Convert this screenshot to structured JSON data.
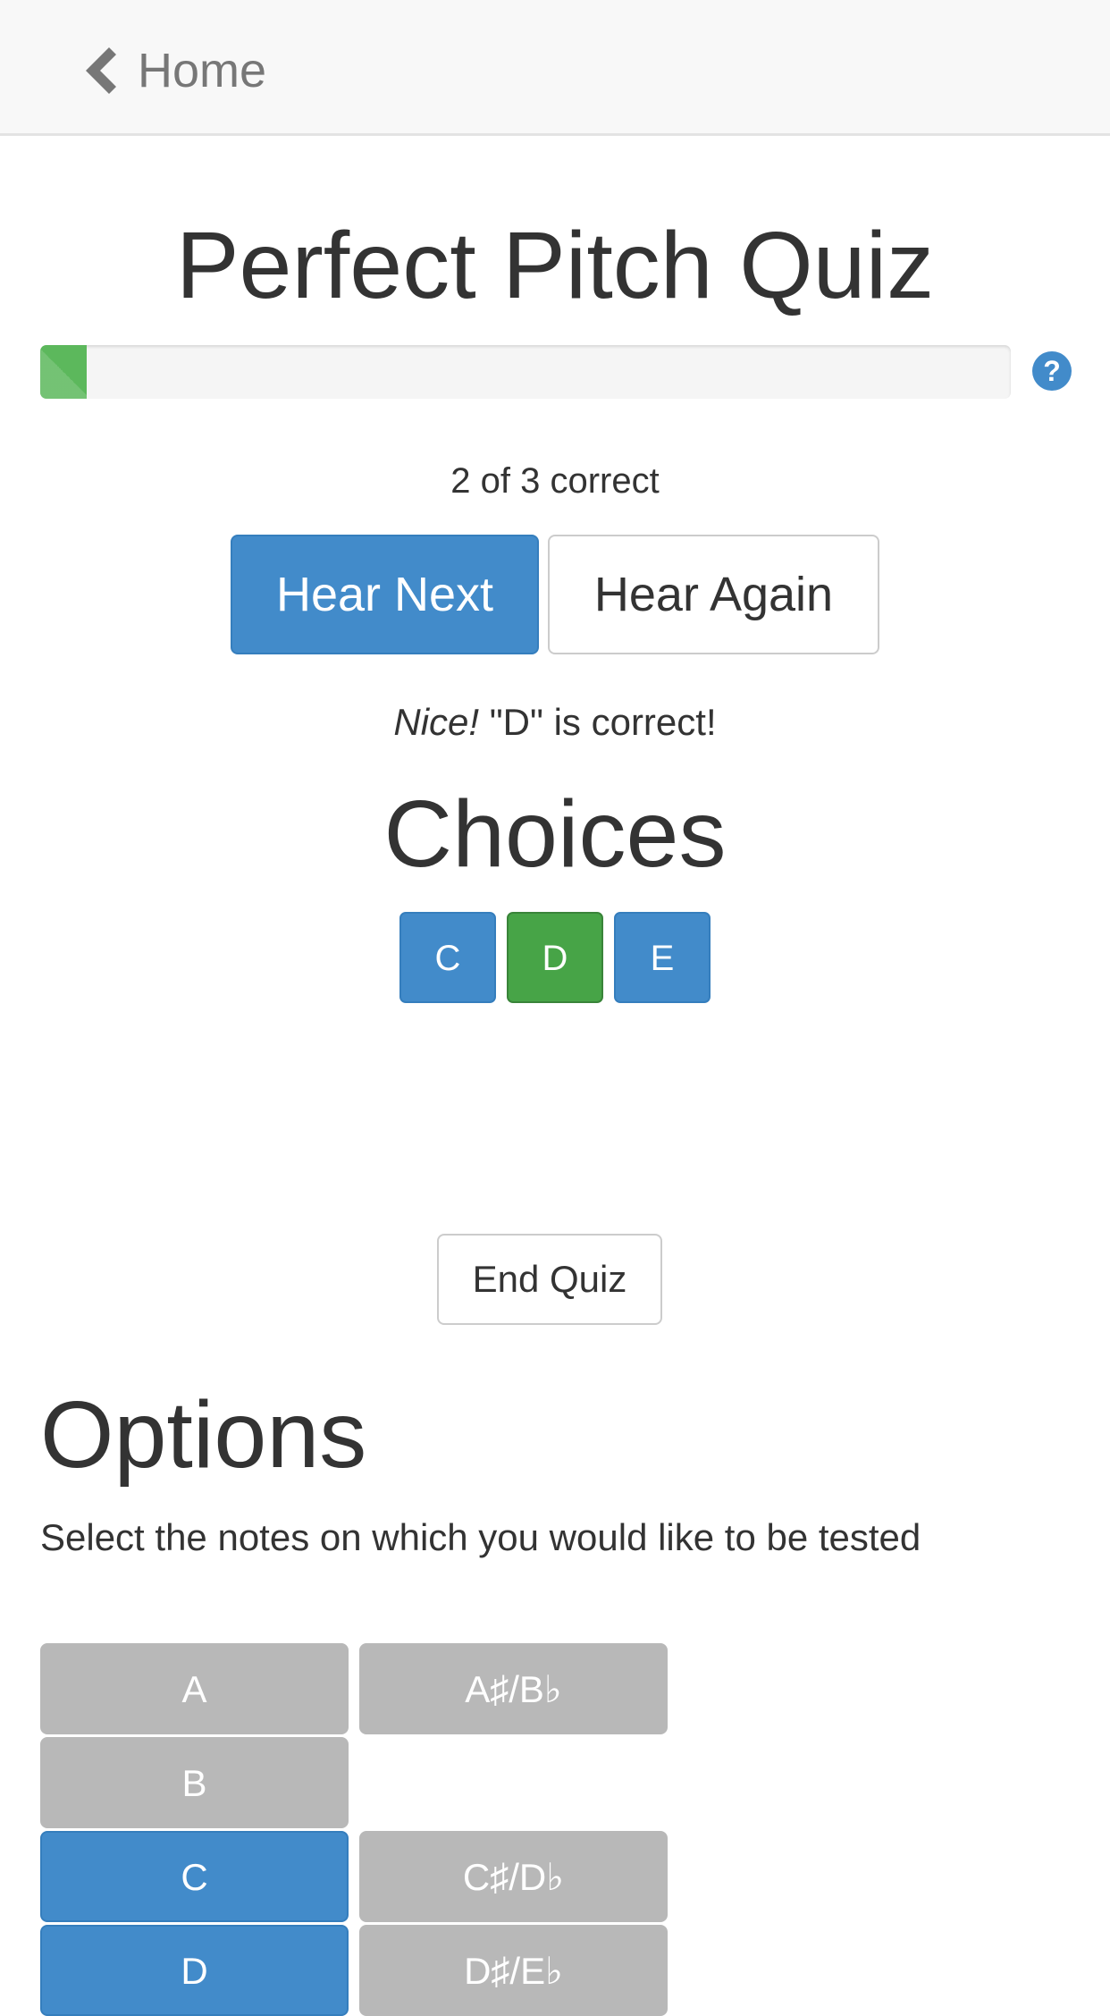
{
  "nav": {
    "home_label": "Home"
  },
  "page_title": "Perfect Pitch Quiz",
  "progress": {
    "fraction": 0.048,
    "bar_color": "#5cb85c",
    "help_icon": "question-circle-icon"
  },
  "score_text": "2 of 3 correct",
  "controls": {
    "hear_next": "Hear Next",
    "hear_again": "Hear Again"
  },
  "feedback": {
    "emphasis": "Nice!",
    "message": " \"D\" is correct!"
  },
  "choices": {
    "heading": "Choices",
    "items": [
      {
        "label": "C",
        "state": "default"
      },
      {
        "label": "D",
        "state": "correct"
      },
      {
        "label": "E",
        "state": "default"
      }
    ]
  },
  "end_quiz_label": "End Quiz",
  "options": {
    "heading": "Options",
    "description": "Select the notes on which you would like to be tested",
    "notes": [
      {
        "label": "A",
        "selected": false
      },
      {
        "label": "A♯/B♭",
        "selected": false
      },
      {
        "label": "B",
        "selected": false
      },
      {
        "label": "C",
        "selected": true
      },
      {
        "label": "C♯/D♭",
        "selected": false
      },
      {
        "label": "D",
        "selected": true
      },
      {
        "label": "D♯/E♭",
        "selected": false
      }
    ]
  },
  "colors": {
    "primary": "#428bca",
    "success": "#47a447",
    "unselected": "#b8b8b8"
  }
}
